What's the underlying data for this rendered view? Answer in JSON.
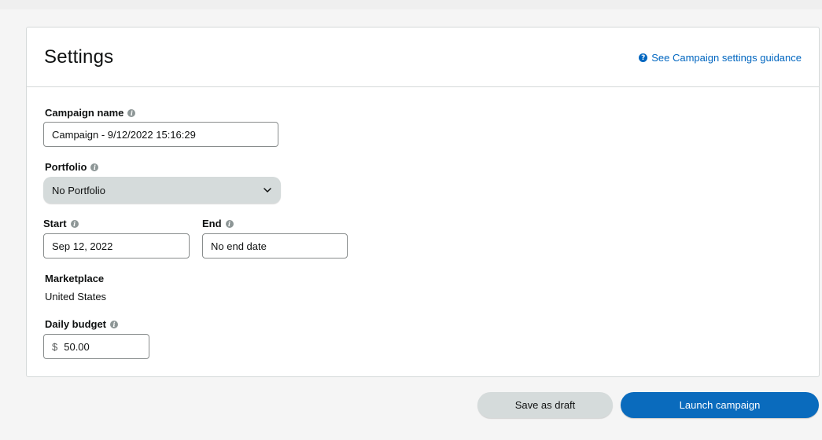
{
  "settings": {
    "title": "Settings",
    "guidance_link": "See Campaign settings guidance",
    "guidance_icon": "?"
  },
  "form": {
    "campaign_name": {
      "label": "Campaign name",
      "value": "Campaign - 9/12/2022 15:16:29"
    },
    "portfolio": {
      "label": "Portfolio",
      "selected": "No Portfolio"
    },
    "start": {
      "label": "Start",
      "value": "Sep 12, 2022"
    },
    "end": {
      "label": "End",
      "value": "No end date"
    },
    "marketplace": {
      "label": "Marketplace",
      "value": "United States"
    },
    "daily_budget": {
      "label": "Daily budget",
      "currency": "$",
      "value": "50.00"
    }
  },
  "actions": {
    "save_draft": "Save as draft",
    "launch": "Launch campaign"
  },
  "colors": {
    "accent": "#0a6bbd",
    "link": "#0066c0",
    "panel_border": "#d5d9d9"
  }
}
